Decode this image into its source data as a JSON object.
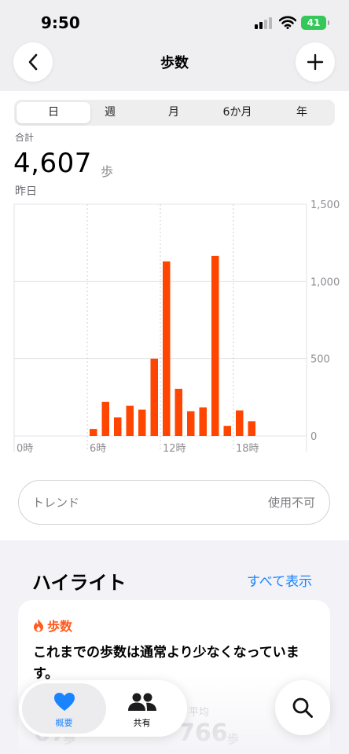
{
  "status_bar": {
    "time": "9:50",
    "battery": "41"
  },
  "nav": {
    "title": "歩数"
  },
  "segments": [
    "日",
    "週",
    "月",
    "6か月",
    "年"
  ],
  "summary": {
    "label": "合計",
    "value": "4,607",
    "unit": "歩",
    "date": "昨日"
  },
  "chart_data": {
    "type": "bar",
    "title": "",
    "xlabel": "",
    "ylabel": "",
    "ylim": [
      0,
      1500
    ],
    "y_ticks": [
      "1,500",
      "1,000",
      "500",
      "0"
    ],
    "y_tick_values": [
      1500,
      1000,
      500,
      0
    ],
    "x_ticks": [
      "0時",
      "6時",
      "12時",
      "18時"
    ],
    "x_tick_hours": [
      0,
      6,
      12,
      18
    ],
    "grid": true,
    "bar_color": "#ff4500",
    "x": [
      6,
      7,
      8,
      9,
      10,
      11,
      12,
      13,
      14,
      15,
      16,
      17,
      18,
      19
    ],
    "values": [
      45,
      220,
      120,
      195,
      170,
      500,
      1130,
      305,
      160,
      185,
      1165,
      65,
      165,
      95
    ]
  },
  "trend": {
    "label": "トレンド",
    "value": "使用不可"
  },
  "highlights": {
    "title": "ハイライト",
    "show_all": "すべて表示",
    "card": {
      "category": "歩数",
      "text": "これまでの歩数は通常より少なくなっています。",
      "left_value": "67",
      "left_unit": "歩",
      "right_label": "平均",
      "right_value": "766",
      "right_unit": "歩"
    }
  },
  "tabs": [
    {
      "label": "概要",
      "icon": "heart-icon"
    },
    {
      "label": "共有",
      "icon": "people-icon"
    }
  ],
  "colors": {
    "accent": "#ff4500",
    "link": "#1a84ff",
    "tab_active": "#1a84ff"
  }
}
